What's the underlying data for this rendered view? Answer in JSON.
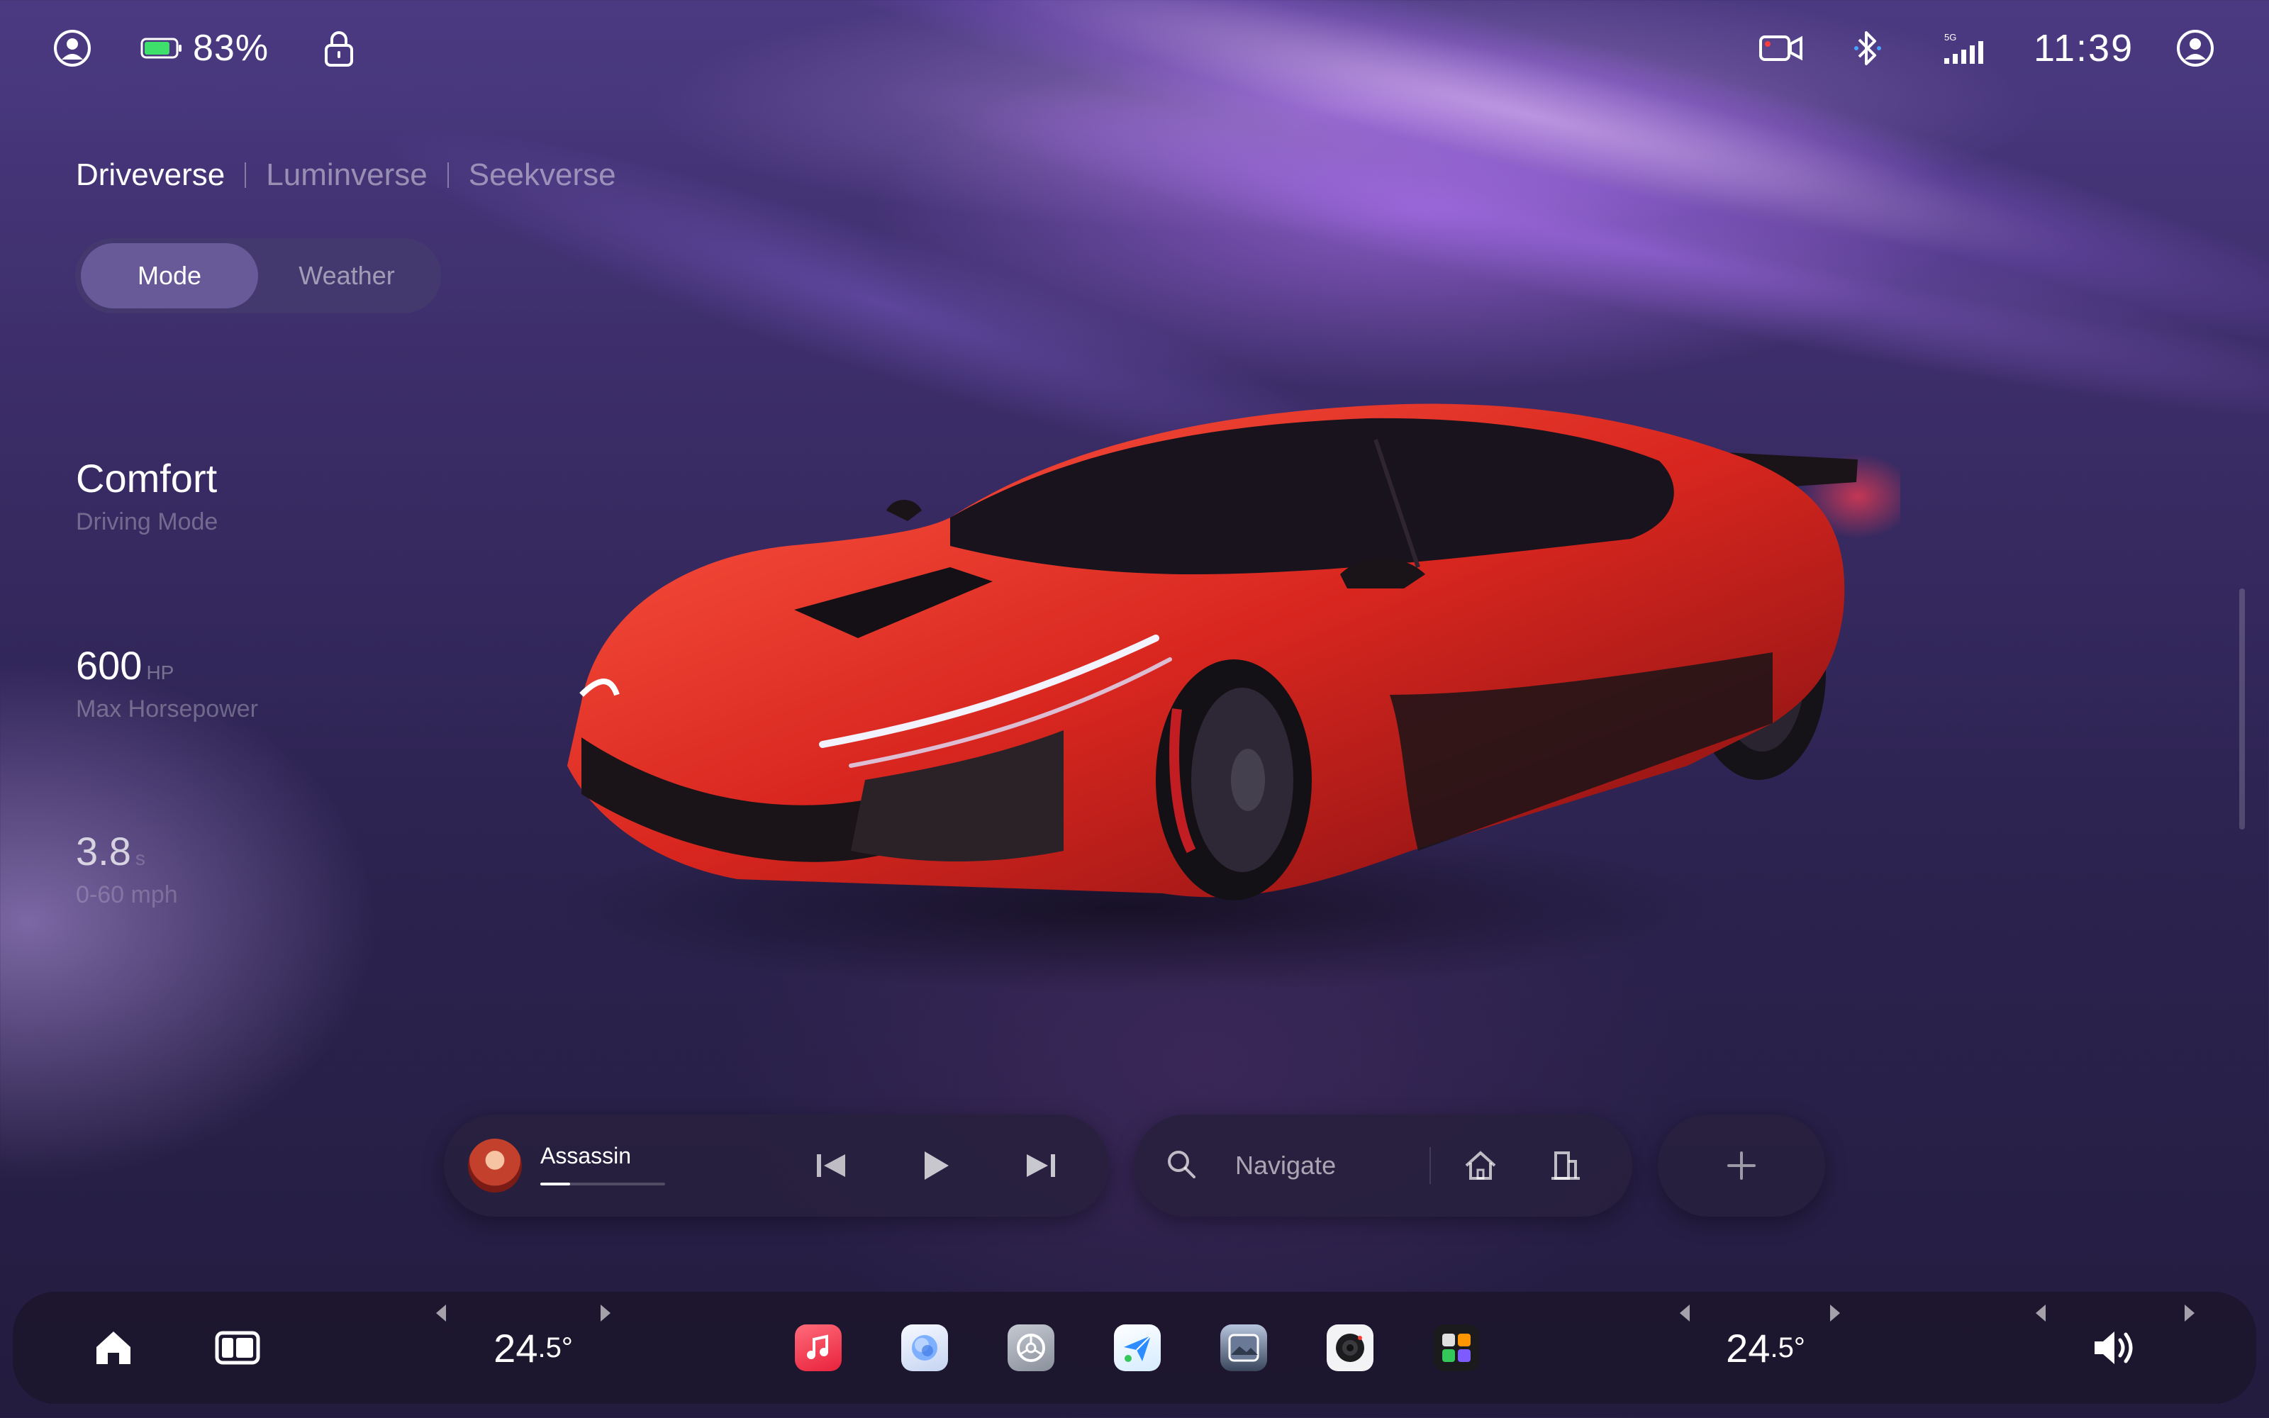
{
  "status": {
    "battery_percent": "83%",
    "battery_level": 0.83,
    "signal_label": "5G",
    "clock": "11:39"
  },
  "verse_tabs": [
    "Driveverse",
    "Luminverse",
    "Seekverse"
  ],
  "segments": [
    "Mode",
    "Weather"
  ],
  "stats": [
    {
      "value": "Comfort",
      "unit": "",
      "label": "Driving Mode"
    },
    {
      "value": "600",
      "unit": "HP",
      "label": "Max Horsepower"
    },
    {
      "value": "3.8",
      "unit": "s",
      "label": "0-60 mph"
    }
  ],
  "media": {
    "track": "Assassin",
    "progress": 0.24
  },
  "navigation": {
    "placeholder": "Navigate"
  },
  "climate": {
    "left_temp_int": "24",
    "left_temp_dec": ".5°",
    "right_temp_int": "24",
    "right_temp_dec": ".5°"
  },
  "dock_apps": [
    {
      "name": "music-app-icon",
      "color": "#f2455a"
    },
    {
      "name": "assistant-app-icon",
      "color": "#dfe7f5"
    },
    {
      "name": "settings-app-icon",
      "color": "#9aa0ab"
    },
    {
      "name": "messages-app-icon",
      "color": "#e6f3ff"
    },
    {
      "name": "gallery-app-icon",
      "color": "#4c5a72"
    },
    {
      "name": "camera-app-icon",
      "color": "#ffffff"
    },
    {
      "name": "apps-grid-icon",
      "color": "#1a1a1a"
    }
  ],
  "colors": {
    "accent": "#9b7bff",
    "car_red": "#e0302b"
  }
}
